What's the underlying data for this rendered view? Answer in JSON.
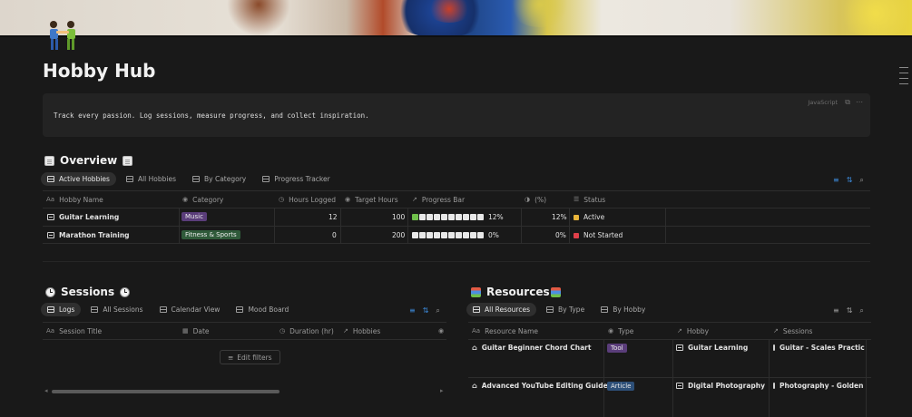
{
  "page": {
    "title": "Hobby Hub",
    "code_text": "Track every passion. Log sessions, measure progress, and collect inspiration.",
    "code_language": "JavaScript"
  },
  "overview": {
    "title": "Overview",
    "tabs": [
      {
        "label": "Active Hobbies",
        "active": true
      },
      {
        "label": "All Hobbies",
        "active": false
      },
      {
        "label": "By Category",
        "active": false
      },
      {
        "label": "Progress Tracker",
        "active": false
      }
    ],
    "columns": {
      "name": "Hobby Name",
      "category": "Category",
      "hours": "Hours Logged",
      "target": "Target Hours",
      "progress": "Progress Bar",
      "percent": "(%)",
      "status": "Status"
    },
    "rows": [
      {
        "name": "Guitar Learning",
        "category": "Music",
        "category_color": "#5a3d7a",
        "hours": "12",
        "target": "100",
        "progress": 0.12,
        "progress_label": "12%",
        "percent": "12%",
        "status": "Active",
        "status_color": "#e8b43a"
      },
      {
        "name": "Marathon Training",
        "category": "Fitness & Sports",
        "category_color": "#2f5a3a",
        "hours": "0",
        "target": "200",
        "progress": 0,
        "progress_label": "0%",
        "percent": "0%",
        "status": "Not Started",
        "status_color": "#e0404a"
      }
    ]
  },
  "sessions": {
    "title": "Sessions",
    "tabs": [
      {
        "label": "Logs",
        "active": true
      },
      {
        "label": "All Sessions",
        "active": false
      },
      {
        "label": "Calendar View",
        "active": false
      },
      {
        "label": "Mood Board",
        "active": false
      }
    ],
    "columns": {
      "title": "Session Title",
      "date": "Date",
      "duration": "Duration (hr)",
      "hobbies": "Hobbies"
    },
    "edit_filters": "Edit filters"
  },
  "resources": {
    "title": "Resources",
    "tabs": [
      {
        "label": "All Resources",
        "active": true
      },
      {
        "label": "By Type",
        "active": false
      },
      {
        "label": "By Hobby",
        "active": false
      }
    ],
    "columns": {
      "name": "Resource Name",
      "type": "Type",
      "hobby": "Hobby",
      "sessions": "Sessions"
    },
    "rows": [
      {
        "name": "Guitar Beginner Chord Chart",
        "type": "Tool",
        "type_color": "#5a3d7a",
        "hobby": "Guitar Learning",
        "sessions": "Guitar - Scales Practice"
      },
      {
        "name": "Advanced YouTube Editing Guide",
        "type": "Article",
        "type_color": "#2d4f78",
        "hobby": "Digital Photography",
        "sessions": "Photography - Golden Hou"
      }
    ]
  },
  "colors": {
    "accent": "#3d8bdc",
    "background": "#191919"
  }
}
